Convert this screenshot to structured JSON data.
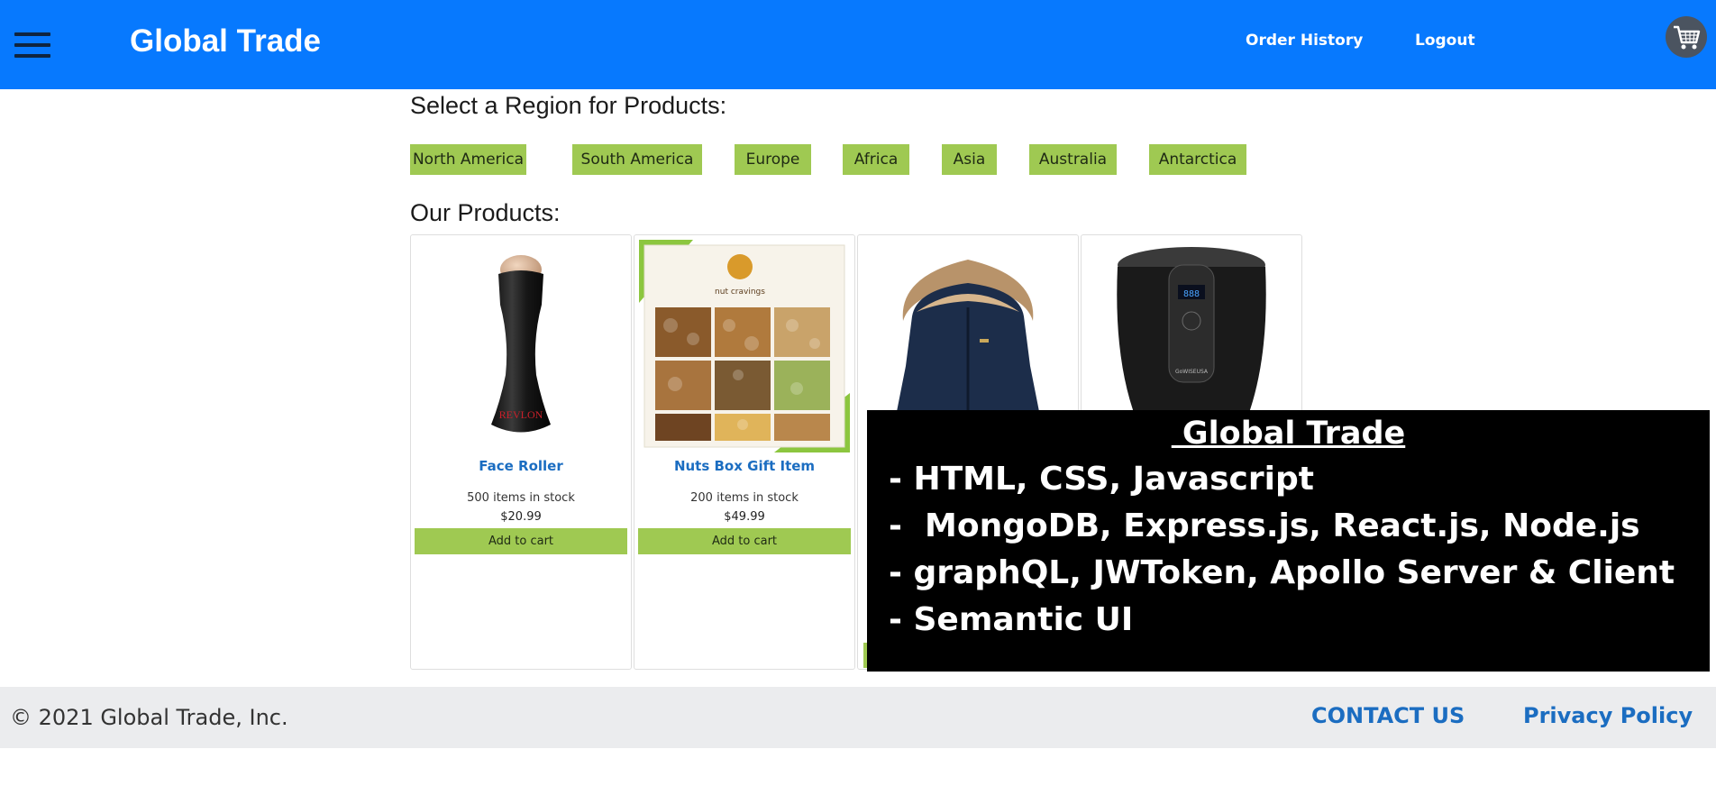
{
  "header": {
    "brand": "Global Trade",
    "nav": [
      {
        "label": "Order History"
      },
      {
        "label": "Logout"
      }
    ],
    "menu_icon": "hamburger-menu-icon",
    "cart_icon": "shopping-cart-icon"
  },
  "regions": {
    "heading": "Select a Region for Products:",
    "items": [
      "North America",
      "South America",
      "Europe",
      "Africa",
      "Asia",
      "Australia",
      "Antarctica"
    ]
  },
  "products": {
    "heading": "Our Products:",
    "items": [
      {
        "name": "Face Roller",
        "stock": "500 items in stock",
        "price": "$20.99",
        "button": "Add to cart",
        "image": "face-roller-image",
        "brand_text": "REVLON"
      },
      {
        "name": "Nuts Box Gift Item",
        "stock": "200 items in stock",
        "price": "$49.99",
        "button": "Add to cart",
        "image": "nuts-gift-box-image",
        "brand_text": "nut cravings"
      },
      {
        "image": "winter-parka-jacket-image"
      },
      {
        "image": "air-fryer-image",
        "display_text": "888",
        "brand_text": "GoWISEUSA"
      }
    ]
  },
  "overlay": {
    "title": " Global Trade",
    "lines": [
      "- HTML, CSS, Javascript",
      "-  MongoDB, Express.js, React.js, Node.js",
      "- graphQL, JWToken, Apollo Server & Client",
      "- Semantic UI"
    ]
  },
  "footer": {
    "copyright": "© 2021 Global Trade, Inc.",
    "links": [
      "CONTACT US",
      "Privacy Policy"
    ]
  },
  "colors": {
    "header_bg": "#0779fe",
    "accent_green": "#9fc952",
    "link_blue": "#1b6dc1",
    "footer_bg": "#ebecee",
    "overlay_bg": "#000000"
  }
}
